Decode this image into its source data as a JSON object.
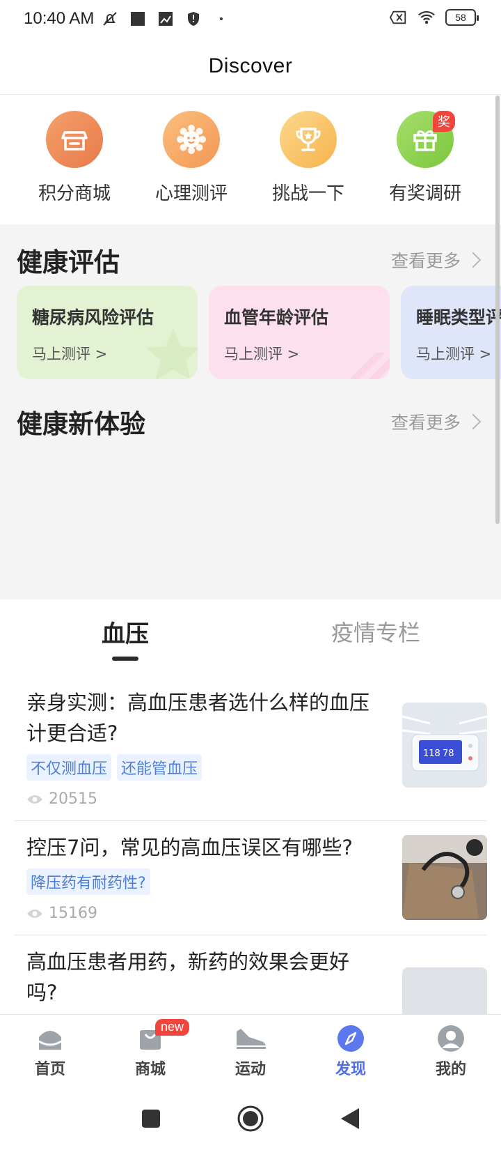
{
  "status_bar": {
    "time": "10:40 AM",
    "battery": "58"
  },
  "header": {
    "title": "Discover"
  },
  "quick_entries": [
    {
      "label": "积分商城",
      "icon": "shop-icon",
      "color": "#ee8a55"
    },
    {
      "label": "心理测评",
      "icon": "smile-flower-icon",
      "color": "#f7a860"
    },
    {
      "label": "挑战一下",
      "icon": "trophy-icon",
      "color": "#f9c868"
    },
    {
      "label": "有奖调研",
      "icon": "gift-icon",
      "color": "#8fd24e",
      "badge": "奖"
    }
  ],
  "health_assessment": {
    "title": "健康评估",
    "more": "查看更多",
    "cards": [
      {
        "title": "糖尿病风险评估",
        "sub": "马上测评 >",
        "color": "#e3f2d3"
      },
      {
        "title": "血管年龄评估",
        "sub": "马上测评 >",
        "color": "#fde0ee"
      },
      {
        "title": "睡眠类型评估",
        "sub": "马上测评 >",
        "color": "#dfe6fa"
      }
    ]
  },
  "health_experience": {
    "title": "健康新体验",
    "more": "查看更多"
  },
  "tabs": [
    {
      "label": "血压",
      "active": true
    },
    {
      "label": "疫情专栏",
      "active": false
    }
  ],
  "articles": [
    {
      "title": "亲身实测：高血压患者选什么样的血压计更合适?",
      "tags": [
        "不仅测血压",
        "还能管血压"
      ],
      "views": "20515"
    },
    {
      "title": "控压7问，常见的高血压误区有哪些?",
      "tags": [
        "降压药有耐药性?"
      ],
      "views": "15169"
    },
    {
      "title": "高血压患者用药，新药的效果会更好吗?",
      "tags": [],
      "views": ""
    }
  ],
  "bottom_nav": [
    {
      "label": "首页",
      "icon": "home-icon",
      "active": false
    },
    {
      "label": "商城",
      "icon": "shopping-bag-icon",
      "active": false,
      "badge": "new"
    },
    {
      "label": "运动",
      "icon": "shoe-icon",
      "active": false
    },
    {
      "label": "发现",
      "icon": "compass-icon",
      "active": true
    },
    {
      "label": "我的",
      "icon": "user-icon",
      "active": false
    }
  ],
  "colors": {
    "accent": "#4f6fe8",
    "tag_text": "#4d7fd8",
    "tag_bg": "#eaf2ff",
    "badge": "#f2453d"
  }
}
